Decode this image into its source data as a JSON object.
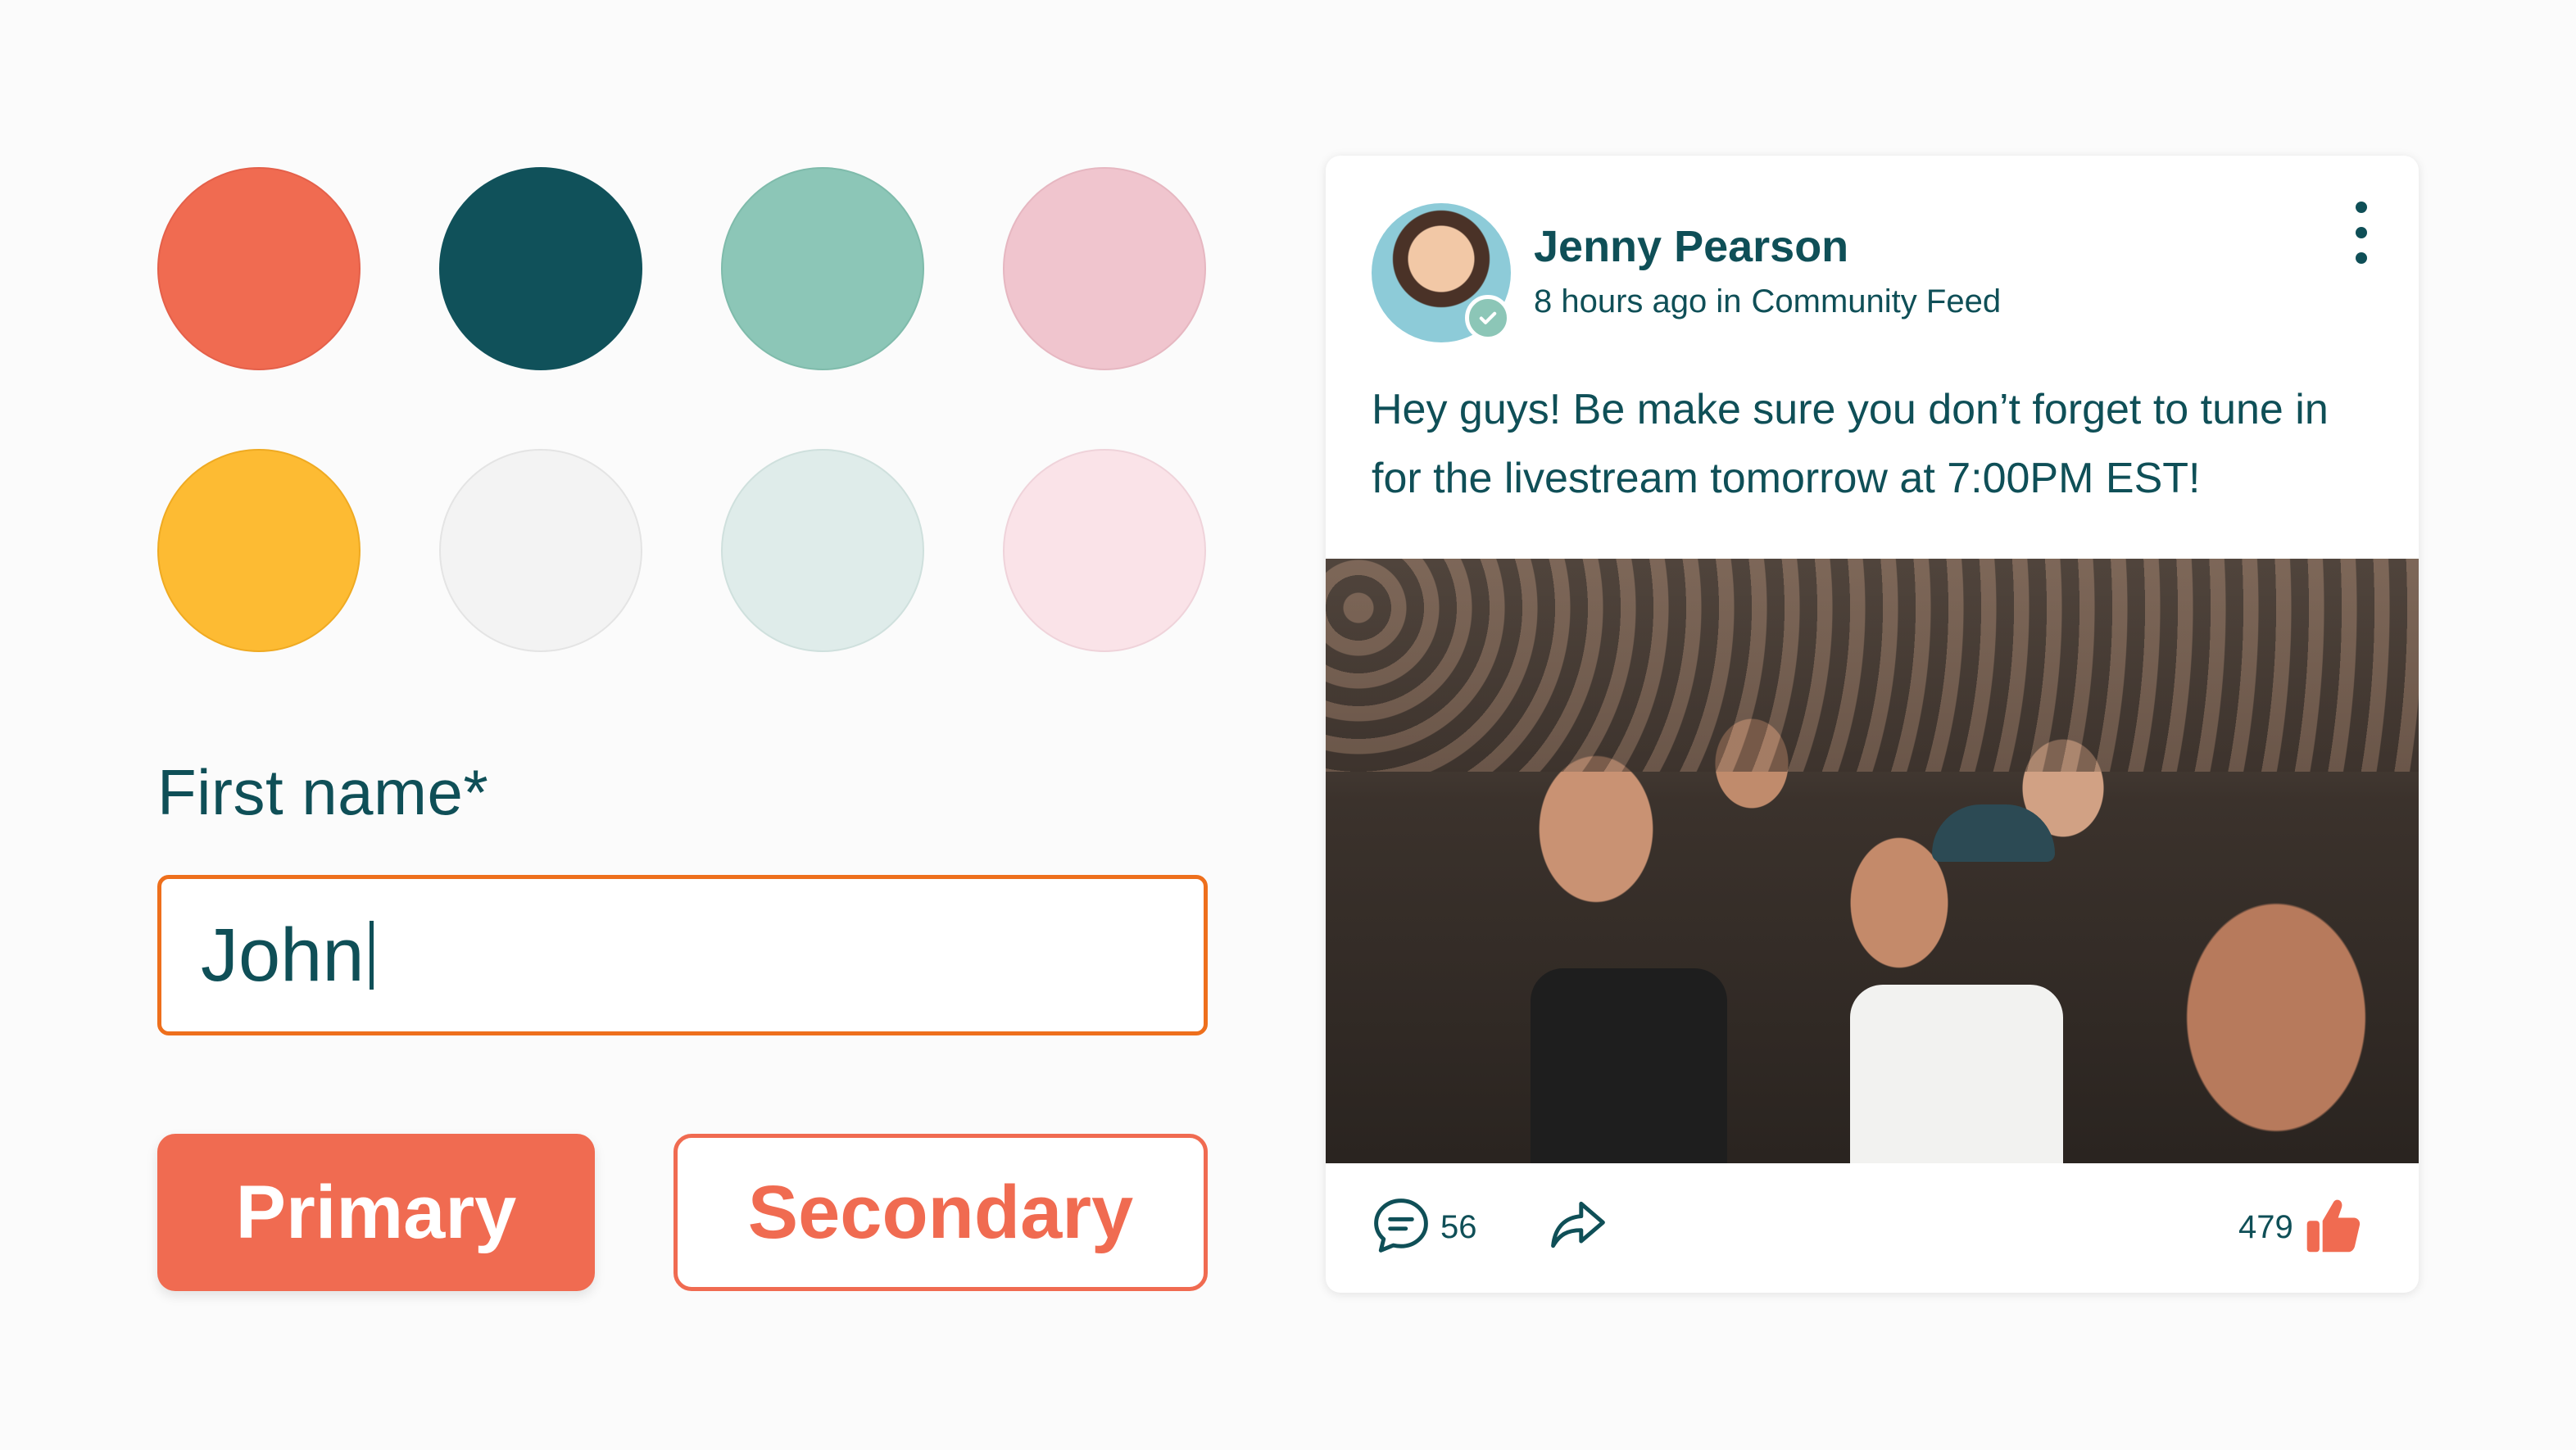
{
  "palette": {
    "colors": [
      "#f06b51",
      "#10515a",
      "#8cc6b7",
      "#f0c5ce",
      "#fdbb33",
      "#f3f3f3",
      "#dfecea",
      "#fae3e8"
    ]
  },
  "form": {
    "label": "First name*",
    "value": "John"
  },
  "buttons": {
    "primary_label": "Primary",
    "secondary_label": "Secondary"
  },
  "post": {
    "author": "Jenny Pearson",
    "time": "8 hours ago in",
    "feed": "Community Feed",
    "text": "Hey guys! Be make sure you don’t forget to tune in for the livestream tomorrow at 7:00PM EST!",
    "comment_count": "56",
    "like_count": "479"
  },
  "colors": {
    "accent": "#f06b51",
    "teal": "#0f4f57",
    "input_border": "#ee6f1c"
  },
  "icons": [
    "check-icon",
    "more-vertical-icon",
    "comment-icon",
    "share-icon",
    "thumbs-up-icon"
  ]
}
